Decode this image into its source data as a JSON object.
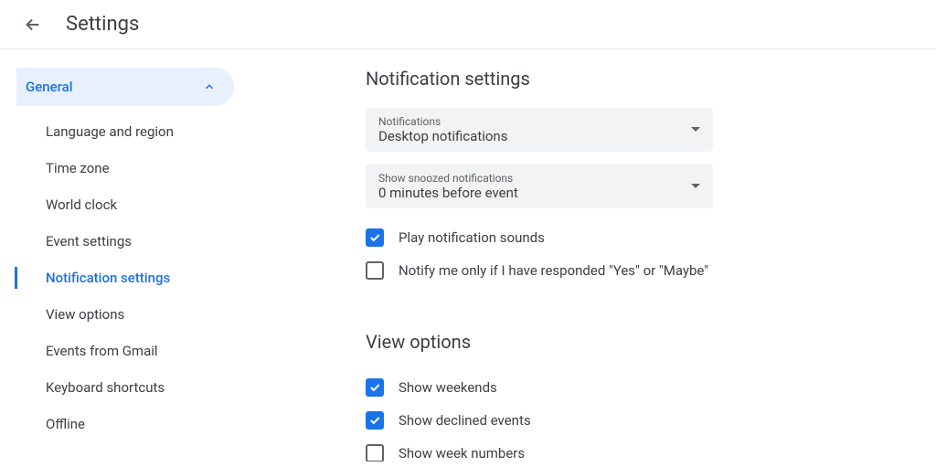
{
  "header": {
    "title": "Settings"
  },
  "sidebar": {
    "category": "General",
    "items": [
      {
        "label": "Language and region",
        "active": false
      },
      {
        "label": "Time zone",
        "active": false
      },
      {
        "label": "World clock",
        "active": false
      },
      {
        "label": "Event settings",
        "active": false
      },
      {
        "label": "Notification settings",
        "active": true
      },
      {
        "label": "View options",
        "active": false
      },
      {
        "label": "Events from Gmail",
        "active": false
      },
      {
        "label": "Keyboard shortcuts",
        "active": false
      },
      {
        "label": "Offline",
        "active": false
      }
    ]
  },
  "main": {
    "notification_section": {
      "title": "Notification settings",
      "dropdowns": [
        {
          "label": "Notifications",
          "value": "Desktop notifications"
        },
        {
          "label": "Show snoozed notifications",
          "value": "0 minutes before event"
        }
      ],
      "checkboxes": [
        {
          "label": "Play notification sounds",
          "checked": true
        },
        {
          "label": "Notify me only if I have responded \"Yes\" or \"Maybe\"",
          "checked": false
        }
      ]
    },
    "view_section": {
      "title": "View options",
      "checkboxes": [
        {
          "label": "Show weekends",
          "checked": true
        },
        {
          "label": "Show declined events",
          "checked": true
        },
        {
          "label": "Show week numbers",
          "checked": false
        }
      ]
    }
  }
}
